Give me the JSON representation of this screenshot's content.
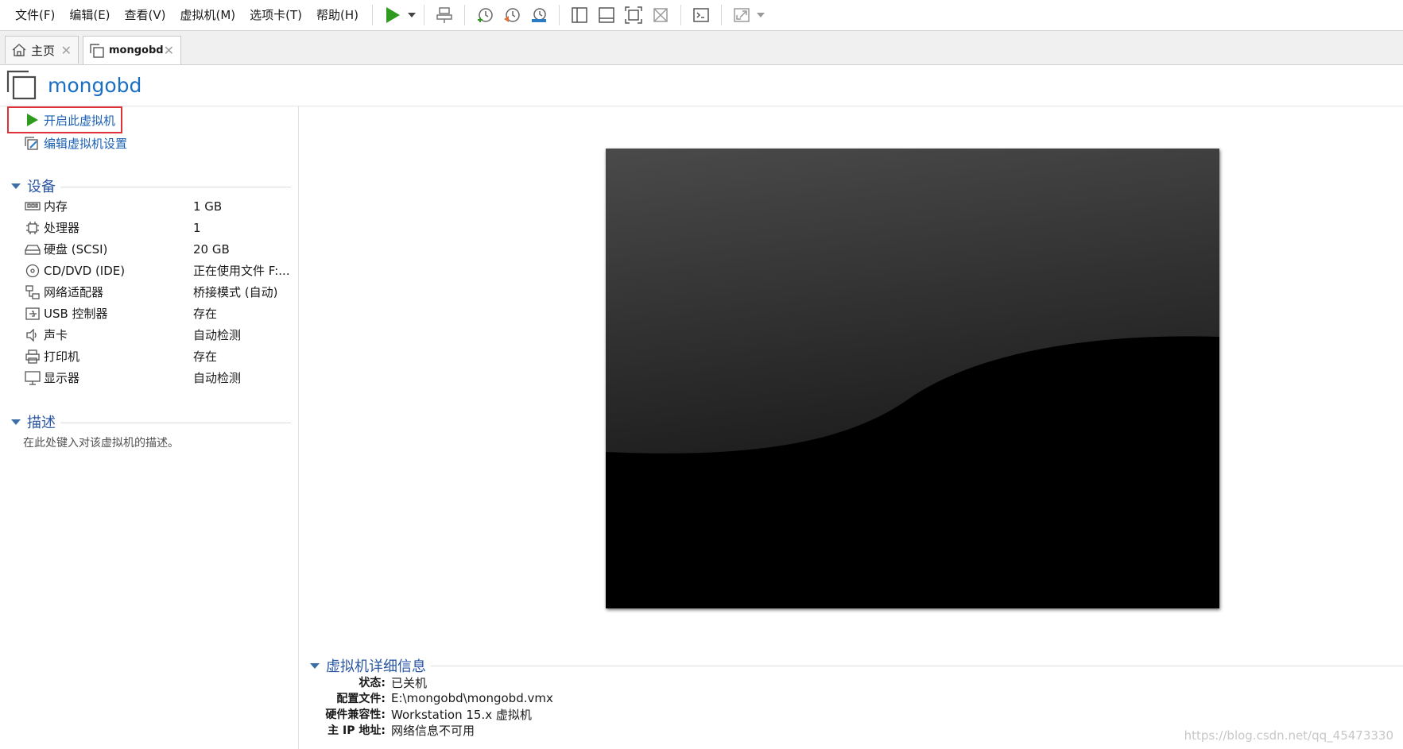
{
  "menu": [
    "文件(F)",
    "编辑(E)",
    "查看(V)",
    "虚拟机(M)",
    "选项卡(T)",
    "帮助(H)"
  ],
  "toolbar": {
    "icons": [
      "play-icon",
      "send-keys-icon",
      "snapshot-take-icon",
      "snapshot-revert-icon",
      "snapshot-manager-icon",
      "library-view-icon",
      "thumbnail-view-icon",
      "fullscreen-icon",
      "unity-icon",
      "console-icon",
      "stretch-icon"
    ],
    "accent": "#2e9a1e"
  },
  "tabs": [
    {
      "label": "主页",
      "icon": "home-icon"
    },
    {
      "label": "mongobd",
      "icon": "vm-icon"
    }
  ],
  "vm": {
    "title": "mongobd",
    "commands": {
      "power_on": "开启此虚拟机",
      "edit_settings": "编辑虚拟机设置"
    },
    "devices_title": "设备",
    "devices": [
      {
        "name": "内存",
        "value": "1 GB",
        "icon": "memory-icon"
      },
      {
        "name": "处理器",
        "value": "1",
        "icon": "processor-icon"
      },
      {
        "name": "硬盘 (SCSI)",
        "value": "20 GB",
        "icon": "hard-disk-icon"
      },
      {
        "name": "CD/DVD (IDE)",
        "value": "正在使用文件 F:...",
        "icon": "cd-dvd-icon"
      },
      {
        "name": "网络适配器",
        "value": "桥接模式 (自动)",
        "icon": "network-adapter-icon"
      },
      {
        "name": "USB 控制器",
        "value": "存在",
        "icon": "usb-icon"
      },
      {
        "name": "声卡",
        "value": "自动检测",
        "icon": "sound-icon"
      },
      {
        "name": "打印机",
        "value": "存在",
        "icon": "printer-icon"
      },
      {
        "name": "显示器",
        "value": "自动检测",
        "icon": "display-icon"
      }
    ],
    "description_title": "描述",
    "description_placeholder": "在此处键入对该虚拟机的描述。",
    "details_title": "虚拟机详细信息",
    "details": [
      {
        "key": "状态:",
        "value": "已关机"
      },
      {
        "key": "配置文件:",
        "value": "E:\\mongobd\\mongobd.vmx"
      },
      {
        "key": "硬件兼容性:",
        "value": "Workstation 15.x 虚拟机"
      },
      {
        "key": "主 IP 地址:",
        "value": "网络信息不可用"
      }
    ]
  },
  "watermark": "https://blog.csdn.net/qq_45473330"
}
